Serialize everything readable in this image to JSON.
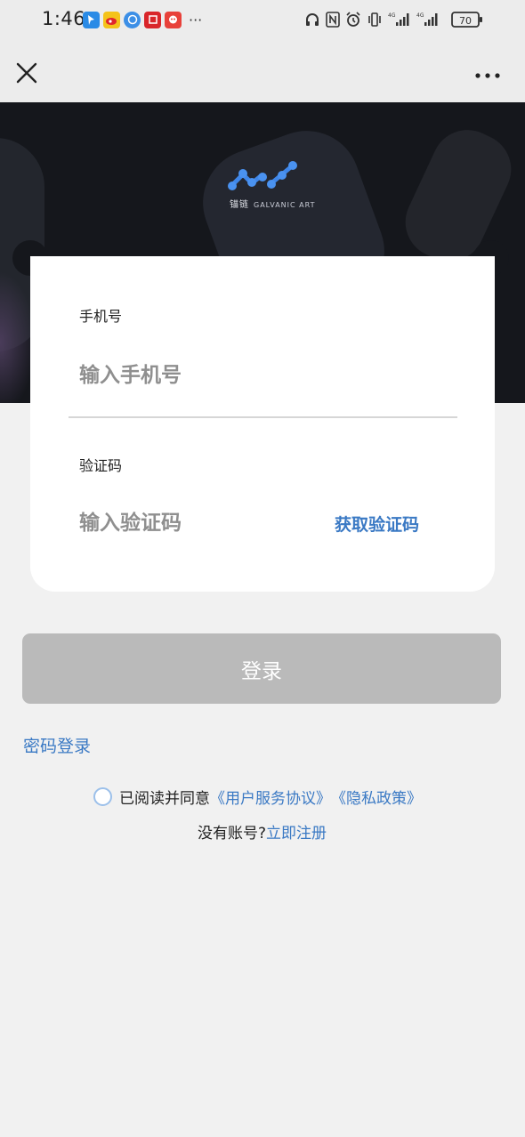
{
  "status_bar": {
    "time": "1:46",
    "more_indicator": "···",
    "battery_level": "70",
    "network_1": "4G",
    "network_2": "4G",
    "app_icons": [
      "map-pin-app-icon",
      "weibo-app-icon",
      "browser-app-icon",
      "news-app-icon",
      "chat-app-icon"
    ]
  },
  "header": {
    "close_icon": "close-icon",
    "more_icon": "more-dots-icon"
  },
  "banner": {
    "logo_cn": "锚链",
    "logo_en": "GALVANIC ART"
  },
  "form": {
    "phone_label": "手机号",
    "phone_placeholder": "输入手机号",
    "code_label": "验证码",
    "code_placeholder": "输入验证码",
    "get_code": "获取验证码"
  },
  "login_button": "登录",
  "password_login": "密码登录",
  "agreement": {
    "prefix": "已阅读并同意",
    "terms": "《用户服务协议》",
    "privacy": "《隐私政策》"
  },
  "register": {
    "question": "没有账号?",
    "link": "立即注册"
  },
  "colors": {
    "accent": "#3a79c4",
    "button_disabled": "#bababa",
    "banner_bg": "#15171c",
    "page_bg": "#f1f1f1"
  }
}
